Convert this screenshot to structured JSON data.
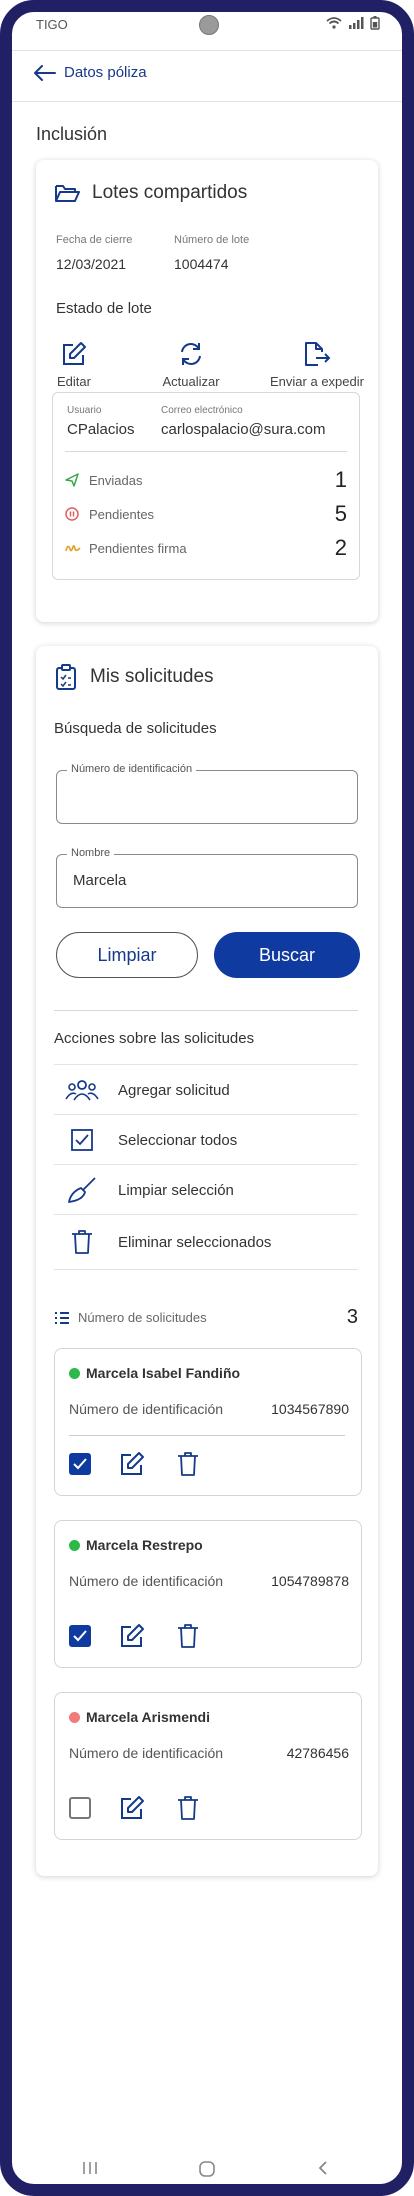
{
  "status": {
    "carrier": "TIGO"
  },
  "nav": {
    "back_label": "Datos póliza"
  },
  "section_title": "Inclusión",
  "lotes": {
    "title": "Lotes compartidos",
    "fecha_label": "Fecha de cierre",
    "fecha_value": "12/03/2021",
    "lote_label": "Número de lote",
    "lote_value": "1004474",
    "estado_label": "Estado de lote",
    "actions": [
      {
        "label": "Editar",
        "icon": "edit-icon"
      },
      {
        "label": "Actualizar",
        "icon": "refresh-icon"
      },
      {
        "label": "Enviar a expedir",
        "icon": "send-file-icon"
      }
    ],
    "usuario_label": "Usuario",
    "usuario_value": "CPalacios",
    "correo_label": "Correo electrónico",
    "correo_value": "carlospalacio@sura.com",
    "stats": [
      {
        "label": "Enviadas",
        "value": "1",
        "icon": "paper-plane-icon",
        "color": "#3aa845"
      },
      {
        "label": "Pendientes",
        "value": "5",
        "icon": "pause-icon",
        "color": "#e06060"
      },
      {
        "label": "Pendientes firma",
        "value": "2",
        "icon": "signature-icon",
        "color": "#e0a020"
      }
    ]
  },
  "solicitudes": {
    "title": "Mis solicitudes",
    "search_title": "Búsqueda de solicitudes",
    "id_field_label": "Número de identificación",
    "id_field_value": "",
    "name_field_label": "Nombre",
    "name_field_value": "Marcela",
    "clear_button": "Limpiar",
    "search_button": "Buscar",
    "actions_title": "Acciones sobre las solicitudes",
    "actions": [
      {
        "label": "Agregar solicitud",
        "icon": "group-icon"
      },
      {
        "label": "Seleccionar todos",
        "icon": "checkbox-icon"
      },
      {
        "label": "Limpiar selección",
        "icon": "broom-icon"
      },
      {
        "label": "Eliminar seleccionados",
        "icon": "trash-icon"
      }
    ],
    "count_label": "Número de solicitudes",
    "count_value": "3",
    "items": [
      {
        "name": "Marcela Isabel Fandiño",
        "id_label": "Número de identificación",
        "id_value": "1034567890",
        "status_color": "#2db84a",
        "checked": true
      },
      {
        "name": "Marcela Restrepo",
        "id_label": "Número de identificación",
        "id_value": "1054789878",
        "status_color": "#2db84a",
        "checked": true
      },
      {
        "name": "Marcela Arismendi",
        "id_label": "Número de identificación",
        "id_value": "42786456",
        "status_color": "#ef7b7b",
        "checked": false
      }
    ]
  },
  "colors": {
    "primary": "#0f3aa0",
    "frame": "#212064",
    "link": "#163a8a"
  }
}
